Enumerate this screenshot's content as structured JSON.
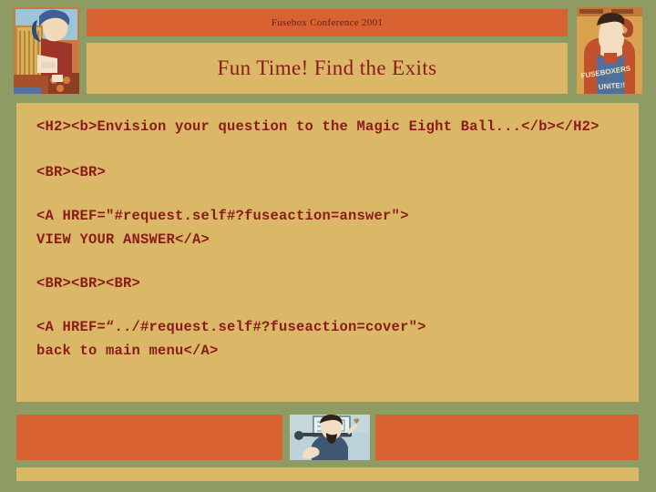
{
  "page": {
    "background_color": "#8e9b62",
    "panel_color": "#dbb868",
    "accent_color": "#d96232",
    "text_color": "#8b1a1a"
  },
  "header": {
    "conference_label": "Fusebox Conference 2001",
    "slide_title": "Fun Time!  Find the Exits",
    "left_image_alt": "roman-soldier-illustration",
    "right_image_alt": "fuseboxers-unite-worker-poster"
  },
  "content": {
    "lines": [
      "<H2><b>Envision your question to the Magic Eight Ball...</b></H2>",
      "<BR><BR>",
      "<A HREF=\"#request.self#?fuseaction=answer\">",
      "VIEW YOUR ANSWER</A>",
      "<BR><BR><BR>",
      "<A HREF=“../#request.self#?fuseaction=cover\">",
      "back to main menu</A>"
    ]
  },
  "footer": {
    "center_image_alt": "man-at-whiteboard-illustration"
  }
}
